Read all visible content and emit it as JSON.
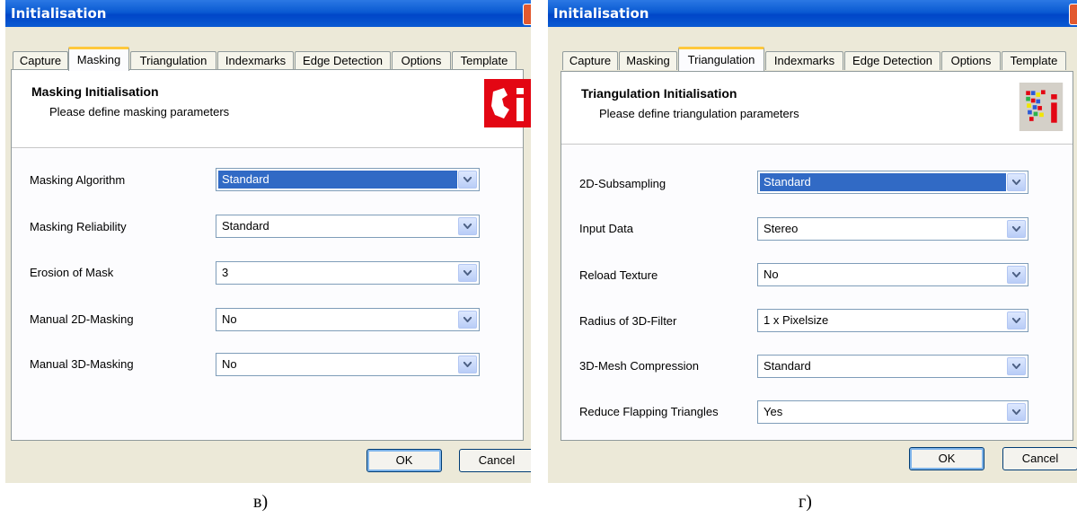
{
  "left": {
    "title": "Initialisation",
    "tabs": [
      "Capture",
      "Masking",
      "Triangulation",
      "Indexmarks",
      "Edge Detection",
      "Options",
      "Template"
    ],
    "active_tab": "Masking",
    "header_title": "Masking Initialisation",
    "header_subtitle": "Please define masking parameters",
    "rows": [
      {
        "label": "Masking Algorithm",
        "value": "Standard"
      },
      {
        "label": "Masking Reliability",
        "value": "Standard"
      },
      {
        "label": "Erosion of Mask",
        "value": "3"
      },
      {
        "label": "Manual 2D-Masking",
        "value": "No"
      },
      {
        "label": "Manual 3D-Masking",
        "value": "No"
      }
    ],
    "ok_label": "OK",
    "cancel_label": "Cancel",
    "caption": "в)"
  },
  "right": {
    "title": "Initialisation",
    "tabs": [
      "Capture",
      "Masking",
      "Triangulation",
      "Indexmarks",
      "Edge Detection",
      "Options",
      "Template"
    ],
    "active_tab": "Triangulation",
    "header_title": "Triangulation Initialisation",
    "header_subtitle": "Please define triangulation parameters",
    "rows": [
      {
        "label": "2D-Subsampling",
        "value": "Standard"
      },
      {
        "label": "Input Data",
        "value": "Stereo"
      },
      {
        "label": "Reload Texture",
        "value": "No"
      },
      {
        "label": "Radius of 3D-Filter",
        "value": "1 x Pixelsize"
      },
      {
        "label": "3D-Mesh Compression",
        "value": "Standard"
      },
      {
        "label": "Reduce Flapping Triangles",
        "value": "Yes"
      }
    ],
    "ok_label": "OK",
    "cancel_label": "Cancel",
    "caption": "г)"
  },
  "colors": {
    "titlebar": "#0a5ad2",
    "dialog_bg": "#ece9d8",
    "selection": "#316ac5",
    "active_tab_accent": "#ffc83c",
    "logo_red": "#e30613"
  },
  "icons": [
    "dropdown-arrow-icon",
    "close-icon",
    "app-logo-icon"
  ]
}
